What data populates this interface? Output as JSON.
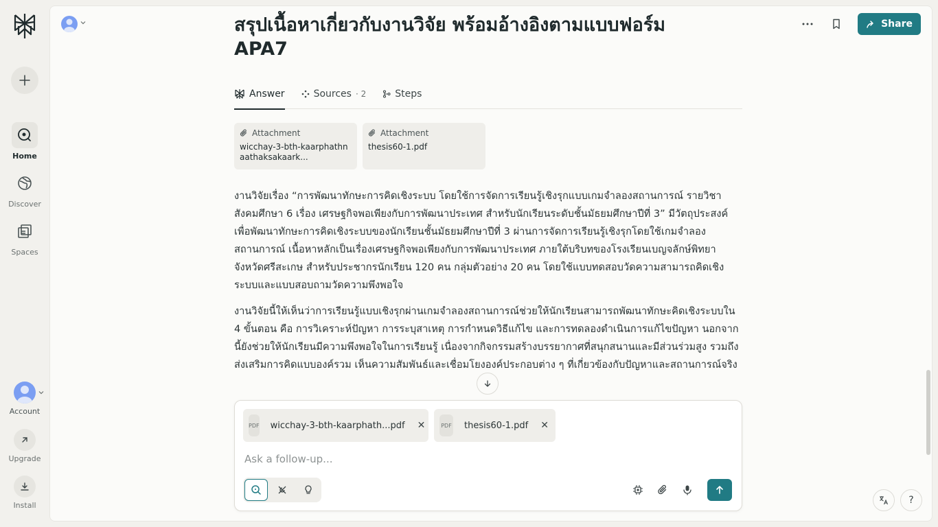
{
  "sidebar": {
    "nav": [
      {
        "label": "Home",
        "icon": "home-icon",
        "active": true
      },
      {
        "label": "Discover",
        "icon": "globe-icon",
        "active": false
      },
      {
        "label": "Spaces",
        "icon": "spaces-icon",
        "active": false
      }
    ],
    "account_label": "Account",
    "upgrade_label": "Upgrade",
    "install_label": "Install"
  },
  "header": {
    "title": "สรุปเนื้อหาเกี่ยวกับงานวิจัย พร้อมอ้างอิงตามแบบฟอร์ม APA7",
    "share_label": "Share"
  },
  "tabs": [
    {
      "label": "Answer",
      "count": ""
    },
    {
      "label": "Sources",
      "count": "· 2"
    },
    {
      "label": "Steps",
      "count": ""
    }
  ],
  "attachments": [
    {
      "head": "Attachment",
      "name": "wicchay-3-bth-kaarphathnaathaksakaark..."
    },
    {
      "head": "Attachment",
      "name": "thesis60-1.pdf"
    }
  ],
  "answer": {
    "paragraphs": [
      "งานวิจัยเรื่อง “การพัฒนาทักษะการคิดเชิงระบบ โดยใช้การจัดการเรียนรู้เชิงรุกแบบเกมจำลองสถานการณ์ รายวิชาสังคมศึกษา 6 เรื่อง เศรษฐกิจพอเพียงกับการพัฒนาประเทศ สำหรับนักเรียนระดับชั้นมัธยมศึกษาปีที่ 3” มีวัตถุประสงค์เพื่อพัฒนาทักษะการคิดเชิงระบบของนักเรียนชั้นมัธยมศึกษาปีที่ 3 ผ่านการจัดการเรียนรู้เชิงรุกโดยใช้เกมจำลองสถานการณ์ เนื้อหาหลักเป็นเรื่องเศรษฐกิจพอเพียงกับการพัฒนาประเทศ ภายใต้บริบทของโรงเรียนเบญจลักษ์พิทยา จังหวัดศรีสะเกษ สำหรับประชากรนักเรียน 120 คน กลุ่มตัวอย่าง 20 คน โดยใช้แบบทดสอบวัดความสามารถคิดเชิงระบบและแบบสอบถามวัดความพึงพอใจ",
      "งานวิจัยนี้ให้เห็นว่าการเรียนรู้แบบเชิงรุกผ่านเกมจำลองสถานการณ์ช่วยให้นักเรียนสามารถพัฒนาทักษะคิดเชิงระบบใน 4 ขั้นตอน คือ การวิเคราะห์ปัญหา การระบุสาเหตุ การกำหนดวิธีแก้ไข และการทดลองดำเนินการแก้ไขปัญหา นอกจากนี้ยังช่วยให้นักเรียนมีความพึงพอใจในการเรียนรู้ เนื่องจากกิจกรรมสร้างบรรยากาศที่สนุกสนานและมีส่วนร่วมสูง รวมถึงส่งเสริมการคิดแบบองค์รวม เห็นความสัมพันธ์และเชื่อมโยงองค์ประกอบต่าง ๆ ที่เกี่ยวข้องกับปัญหาและสถานการณ์จริง"
    ]
  },
  "composer": {
    "files": [
      {
        "badge": "PDF",
        "name": "wicchay-3-bth-kaarphath...pdf"
      },
      {
        "badge": "PDF",
        "name": "thesis60-1.pdf"
      }
    ],
    "placeholder": "Ask a follow-up..."
  },
  "colors": {
    "accent": "#217b84",
    "background": "#f2f1ed",
    "panel": "#fbfbf9"
  }
}
